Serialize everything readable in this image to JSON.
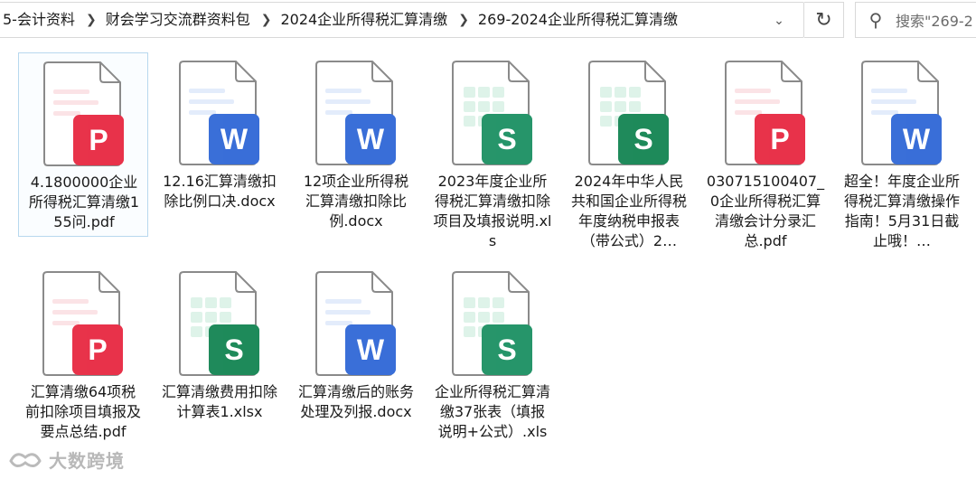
{
  "breadcrumb": [
    "5-会计资料",
    "财会学习交流群资料包",
    "2024企业所得税汇算清缴",
    "269-2024企业所得税汇算清缴"
  ],
  "search": {
    "placeholder": "搜索\"269-2"
  },
  "files": [
    {
      "name": "4.1800000企业所得税汇算清缴155问.pdf",
      "type": "pdf",
      "selected": true
    },
    {
      "name": "12.16汇算清缴扣除比例口决.docx",
      "type": "docx"
    },
    {
      "name": "12项企业所得税汇算清缴扣除比例.docx",
      "type": "docx"
    },
    {
      "name": "2023年度企业所得税汇算清缴扣除项目及填报说明.xls",
      "type": "xls"
    },
    {
      "name": "2024年中华人民共和国企业所得税年度纳税申报表（带公式）2…",
      "type": "xlsx"
    },
    {
      "name": "030715100407_0企业所得税汇算清缴会计分录汇总.pdf",
      "type": "pdf"
    },
    {
      "name": "超全！年度企业所得税汇算清缴操作指南！5月31日截止哦！…",
      "type": "docx"
    },
    {
      "name": "汇算清缴64项税前扣除项目填报及要点总结.pdf",
      "type": "pdf"
    },
    {
      "name": "汇算清缴费用扣除计算表1.xlsx",
      "type": "xlsx"
    },
    {
      "name": "汇算清缴后的账务处理及列报.docx",
      "type": "docx"
    },
    {
      "name": "企业所得税汇算清缴37张表（填报说明+公式）.xls",
      "type": "xls"
    }
  ],
  "badges": {
    "pdf": "P",
    "docx": "W",
    "xls": "S",
    "xlsx": "S"
  },
  "colors": {
    "pdf": "#e8334a",
    "docx": "#3a6fd8",
    "xls": "#27956a",
    "xlsx": "#1f8a5b"
  },
  "watermark": "大数跨境"
}
